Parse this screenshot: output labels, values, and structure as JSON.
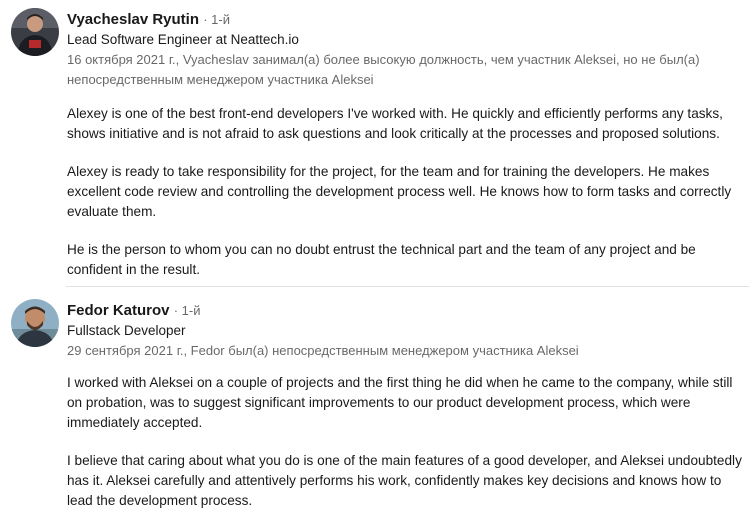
{
  "recommendations": [
    {
      "name": "Vyacheslav Ryutin",
      "degree": "· 1-й",
      "headline": "Lead Software Engineer at Neattech.io",
      "meta": "16 октября 2021 г., Vyacheslav занимал(а) более высокую должность, чем участник Aleksei, но не был(а) непосредственным менеджером участника Aleksei",
      "paragraphs": [
        "Alexey is one of the best front-end developers I've worked with. He quickly and efficiently performs any tasks, shows initiative and is not afraid to ask questions and look critically at the processes and proposed solutions.",
        "Alexey is ready to take responsibility for the project, for the team and for training the developers. He makes excellent code review and controlling the development process well. He knows how to form tasks and correctly evaluate them.",
        "He is the person to whom you can no doubt entrust the technical part and the team of any project and be confident in the result."
      ]
    },
    {
      "name": "Fedor Katurov",
      "degree": "· 1-й",
      "headline": "Fullstack Developer",
      "meta": "29 сентября 2021 г., Fedor был(а) непосредственным менеджером участника Aleksei",
      "paragraphs": [
        "I worked with Aleksei on a couple of projects and the first thing he did when he came to the company, while still on probation, was to suggest significant improvements to our product development process, which were immediately accepted.",
        "I believe that caring about what you do is one of the main features of a good developer, and Aleksei undoubtedly has it. Aleksei carefully and attentively performs his work, confidently makes key decisions and knows how to lead the development process."
      ]
    }
  ],
  "icons": {
    "avatar1": "profile-photo",
    "avatar2": "profile-photo"
  }
}
